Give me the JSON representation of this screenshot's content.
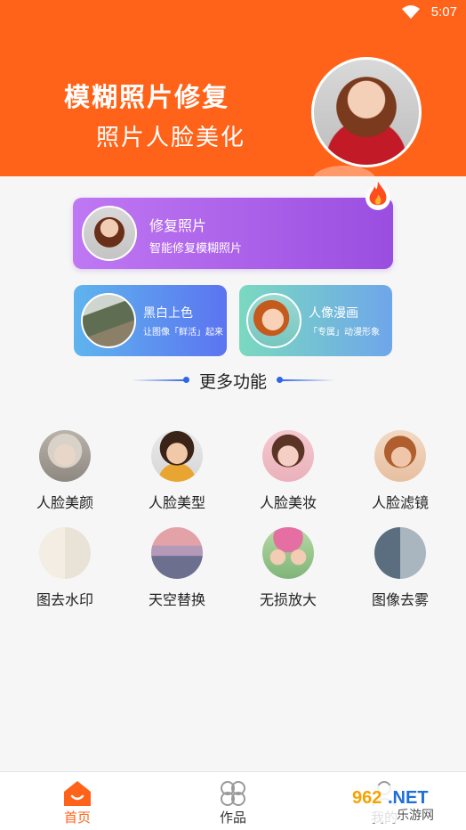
{
  "status_bar": {
    "time": "5:07"
  },
  "header": {
    "title": "模糊照片修复",
    "subtitle": "照片人脸美化"
  },
  "main_feature": {
    "title": "修复照片",
    "desc": "智能修复模糊照片"
  },
  "cards": [
    {
      "title": "黑白上色",
      "desc": "让图像「鲜活」起来"
    },
    {
      "title": "人像漫画",
      "desc": "「专属」动漫形象"
    }
  ],
  "more_section": {
    "title": "更多功能"
  },
  "grid": [
    {
      "label": "人脸美颜",
      "icon": "face-beauty-icon"
    },
    {
      "label": "人脸美型",
      "icon": "face-shape-icon"
    },
    {
      "label": "人脸美妆",
      "icon": "face-makeup-icon"
    },
    {
      "label": "人脸滤镜",
      "icon": "face-filter-icon"
    },
    {
      "label": "图去水印",
      "icon": "watermark-remove-icon"
    },
    {
      "label": "天空替换",
      "icon": "sky-replace-icon"
    },
    {
      "label": "无损放大",
      "icon": "upscale-icon"
    },
    {
      "label": "图像去雾",
      "icon": "dehaze-icon"
    }
  ],
  "bottom_nav": {
    "items": [
      {
        "label": "首页",
        "icon": "home-icon",
        "active": true
      },
      {
        "label": "作品",
        "icon": "works-icon",
        "active": false
      },
      {
        "label": "我的",
        "icon": "profile-icon",
        "active": false
      }
    ]
  },
  "colors": {
    "header_bg": "#ff6319",
    "accent_blue": "#2f66e8",
    "nav_active": "#ff6319"
  },
  "watermark": {
    "brand": "962.NET",
    "sub": "乐游网"
  }
}
